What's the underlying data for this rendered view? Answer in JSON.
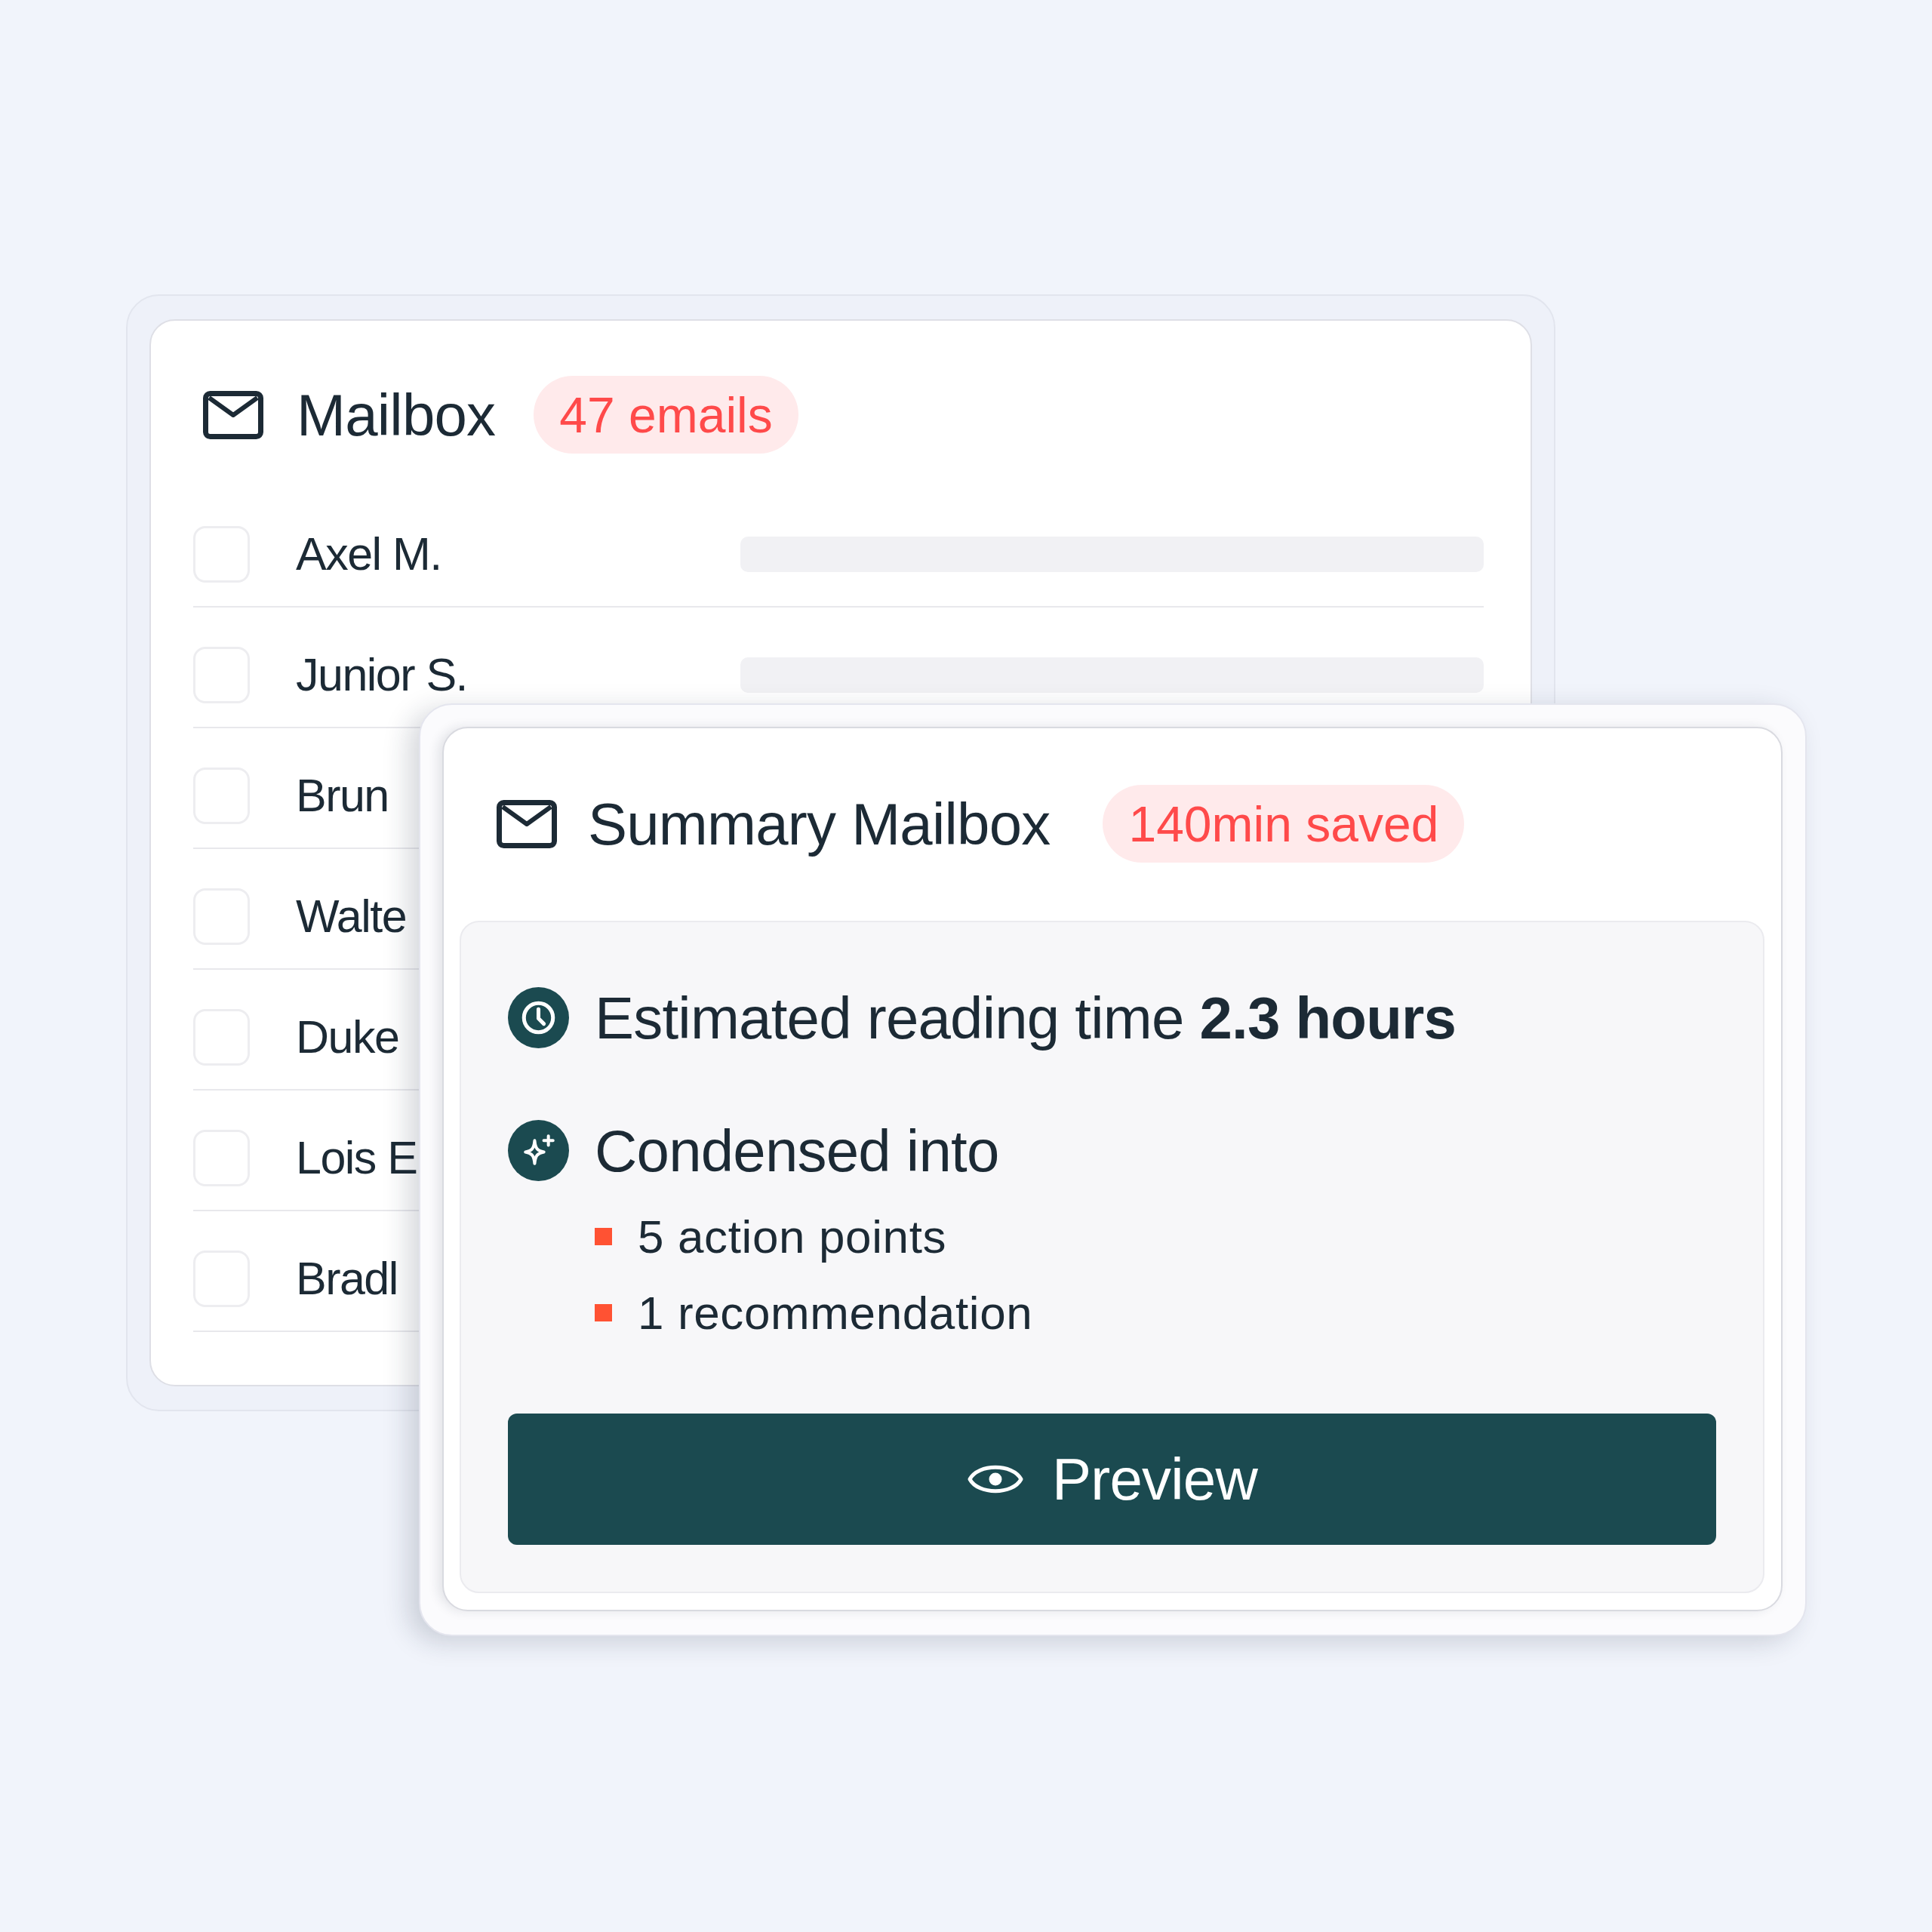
{
  "mailbox": {
    "title": "Mailbox",
    "badge": "47 emails",
    "rows": [
      {
        "name": "Axel M.",
        "checked": false,
        "snippet_bar": true
      },
      {
        "name": "Junior S.",
        "checked": false,
        "snippet_bar": true
      },
      {
        "name": "Brun",
        "checked": false
      },
      {
        "name": "Walte",
        "checked": false
      },
      {
        "name": "Duke",
        "checked": false
      },
      {
        "name": "Lois E",
        "checked": false
      },
      {
        "name": "Bradl",
        "checked": false
      }
    ]
  },
  "summary": {
    "title": "Summary Mailbox",
    "badge": "140min saved",
    "reading_time": "Estimated reading time **2.3 hours**",
    "condensed": {
      "label": "Condensed into",
      "points": [
        "5 action points",
        "1 recommendation"
      ]
    },
    "button": "Preview"
  }
}
